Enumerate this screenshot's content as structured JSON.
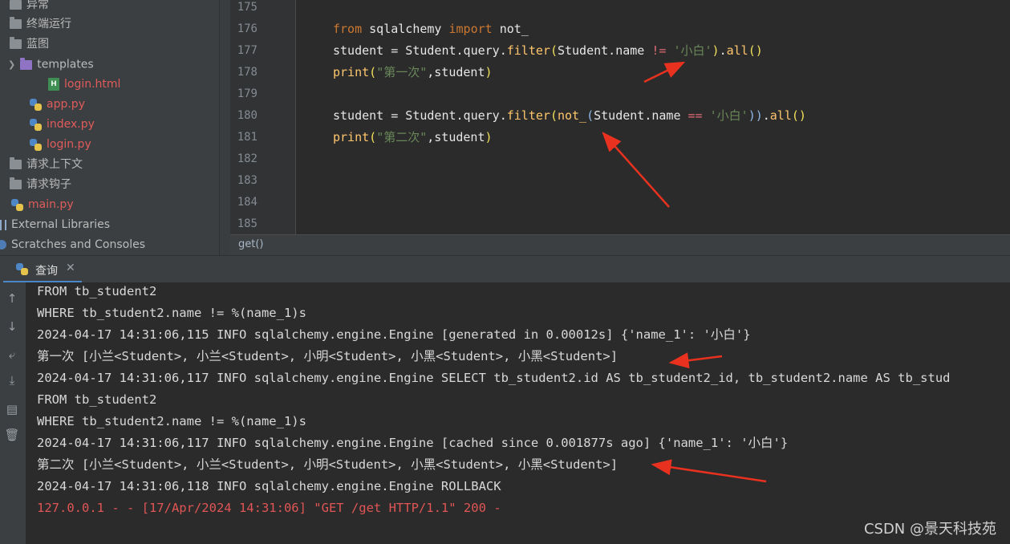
{
  "project_tree": {
    "items": [
      {
        "label": "异常",
        "type": "folder"
      },
      {
        "label": "终端运行",
        "type": "folder"
      },
      {
        "label": "蓝图",
        "type": "folder"
      },
      {
        "label": "templates",
        "type": "folder-open"
      },
      {
        "label": "login.html",
        "type": "html"
      },
      {
        "label": "app.py",
        "type": "py"
      },
      {
        "label": "index.py",
        "type": "py"
      },
      {
        "label": "login.py",
        "type": "py"
      },
      {
        "label": "请求上下文",
        "type": "folder"
      },
      {
        "label": "请求钩子",
        "type": "folder"
      },
      {
        "label": "main.py",
        "type": "py"
      },
      {
        "label": "External Libraries",
        "type": "lib"
      },
      {
        "label": "Scratches and Consoles",
        "type": "scratch"
      }
    ]
  },
  "editor": {
    "line_numbers": [
      "175",
      "176",
      "177",
      "178",
      "179",
      "180",
      "181",
      "182",
      "183",
      "184",
      "185"
    ],
    "code": {
      "l176": {
        "kw1": "from",
        "mod": " sqlalchemy ",
        "kw2": "import",
        "name": " not_"
      },
      "l177": {
        "a": "student = Student.query.",
        "call": "filter",
        "p1": "(",
        "b": "Student.name ",
        "op": "!=",
        "c": " ",
        "s": "'小白'",
        "p2": ")",
        "d": ".",
        "call2": "all",
        "p3": "()"
      },
      "l178": {
        "fn": "print",
        "p1": "(",
        "s": "\"第一次\"",
        "rest": ",student",
        "p2": ")"
      },
      "l180": {
        "a": "student = Student.query.",
        "call": "filter",
        "p1": "(",
        "call2": "not_",
        "p2": "(",
        "b": "Student.name ",
        "op": "==",
        "c": " ",
        "s": "'小白'",
        "p3": "))",
        "d": ".",
        "call3": "all",
        "p4": "()"
      },
      "l181": {
        "fn": "print",
        "p1": "(",
        "s": "\"第二次\"",
        "rest": ",student",
        "p2": ")"
      }
    },
    "breadcrumb": "get()"
  },
  "run": {
    "tab_label": "查询",
    "console_lines": [
      "FROM tb_student2",
      "WHERE tb_student2.name != %(name_1)s",
      "2024-04-17 14:31:06,115 INFO sqlalchemy.engine.Engine [generated in 0.00012s] {'name_1': '小白'}",
      "第一次 [小兰<Student>, 小兰<Student>, 小明<Student>, 小黑<Student>, 小黑<Student>]",
      "2024-04-17 14:31:06,117 INFO sqlalchemy.engine.Engine SELECT tb_student2.id AS tb_student2_id, tb_student2.name AS tb_stud",
      "FROM tb_student2",
      "WHERE tb_student2.name != %(name_1)s",
      "2024-04-17 14:31:06,117 INFO sqlalchemy.engine.Engine [cached since 0.001877s ago] {'name_1': '小白'}",
      "第二次 [小兰<Student>, 小兰<Student>, 小明<Student>, 小黑<Student>, 小黑<Student>]",
      "2024-04-17 14:31:06,118 INFO sqlalchemy.engine.Engine ROLLBACK",
      "127.0.0.1 - - [17/Apr/2024 14:31:06] \"GET /get HTTP/1.1\" 200 -"
    ]
  },
  "watermark": "CSDN @景天科技苑",
  "colors": {
    "accent": "#4a88c7",
    "arrow": "#e8321f",
    "error_text": "#e05555"
  }
}
